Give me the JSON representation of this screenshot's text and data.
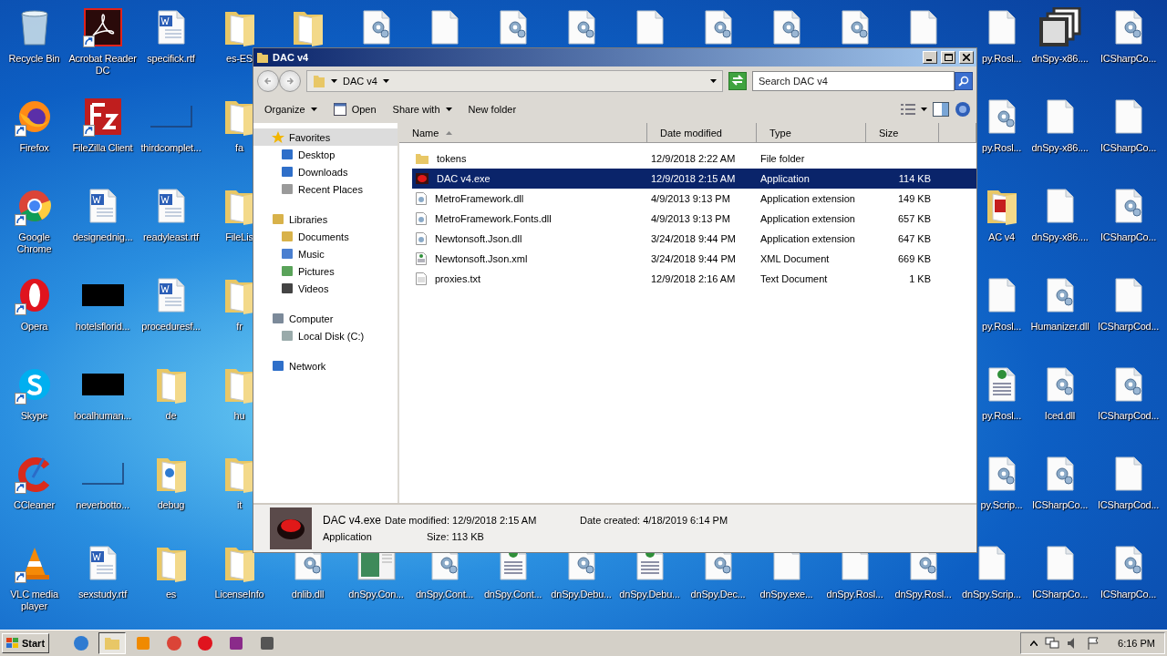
{
  "desktop": {
    "columns": [
      {
        "kind": "full",
        "items": [
          {
            "kind": "recycle",
            "label": "Recycle Bin",
            "shortcut": false
          },
          {
            "kind": "firefox",
            "label": "Firefox",
            "shortcut": true
          },
          {
            "kind": "chrome",
            "label": "Google Chrome",
            "shortcut": true
          },
          {
            "kind": "opera",
            "label": "Opera",
            "shortcut": true
          },
          {
            "kind": "skype",
            "label": "Skype",
            "shortcut": true
          },
          {
            "kind": "ccleaner",
            "label": "CCleaner",
            "shortcut": true
          },
          {
            "kind": "vlc",
            "label": "VLC media player",
            "shortcut": true
          }
        ]
      },
      {
        "kind": "full",
        "items": [
          {
            "kind": "acrobat",
            "label": "Acrobat Reader DC",
            "shortcut": true
          },
          {
            "kind": "filezilla",
            "label": "FileZilla Client",
            "shortcut": true
          },
          {
            "kind": "word",
            "label": "designednig...",
            "shortcut": false
          },
          {
            "kind": "redacted",
            "label": "hotelsflorid...",
            "shortcut": false
          },
          {
            "kind": "redacted",
            "label": "localhuman...",
            "shortcut": false
          },
          {
            "kind": "thin",
            "label": "neverbotto...",
            "shortcut": false
          },
          {
            "kind": "word",
            "label": "sexstudy.rtf",
            "shortcut": false
          }
        ]
      },
      {
        "kind": "full",
        "items": [
          {
            "kind": "word",
            "label": "specifick.rtf",
            "shortcut": false
          },
          {
            "kind": "thin",
            "label": "thirdcomplet...",
            "shortcut": false
          },
          {
            "kind": "word",
            "label": "readyleast.rtf",
            "shortcut": false
          },
          {
            "kind": "word",
            "label": "proceduresf...",
            "shortcut": false
          },
          {
            "kind": "folder",
            "label": "de",
            "shortcut": false
          },
          {
            "kind": "folderweb",
            "label": "debug",
            "shortcut": false
          },
          {
            "kind": "folder",
            "label": "es",
            "shortcut": false
          }
        ]
      },
      {
        "kind": "full",
        "items": [
          {
            "kind": "folder",
            "label": "es-ES",
            "shortcut": false
          },
          {
            "kind": "folder",
            "label": "fa",
            "shortcut": false
          },
          {
            "kind": "folder",
            "label": "FileLis",
            "shortcut": false
          },
          {
            "kind": "folder",
            "label": "fr",
            "shortcut": false
          },
          {
            "kind": "folder",
            "label": "hu",
            "shortcut": false
          },
          {
            "kind": "folder",
            "label": "it",
            "shortcut": false
          },
          {
            "kind": "folder",
            "label": "LicenseInfo",
            "shortcut": false
          }
        ]
      },
      {
        "kind": "edges",
        "items": [
          {
            "kind": "folder",
            "shortcut": false
          },
          {
            "kind": "gear",
            "label": "dnlib.dll",
            "shortcut": false
          }
        ]
      },
      {
        "kind": "edges",
        "items": [
          {
            "kind": "gear",
            "shortcut": false
          },
          {
            "kind": "image",
            "label": "dnSpy.Con...",
            "shortcut": false
          }
        ]
      },
      {
        "kind": "edges",
        "items": [
          {
            "kind": "blank",
            "shortcut": false
          },
          {
            "kind": "gear",
            "label": "dnSpy.Cont...",
            "shortcut": false
          }
        ]
      },
      {
        "kind": "edges",
        "items": [
          {
            "kind": "gear",
            "shortcut": false
          },
          {
            "kind": "web",
            "label": "dnSpy.Cont...",
            "shortcut": false
          }
        ]
      },
      {
        "kind": "edges",
        "items": [
          {
            "kind": "gear",
            "shortcut": false
          },
          {
            "kind": "gear",
            "label": "dnSpy.Debu...",
            "shortcut": false
          }
        ]
      },
      {
        "kind": "edges",
        "items": [
          {
            "kind": "blank",
            "shortcut": false
          },
          {
            "kind": "web",
            "label": "dnSpy.Debu...",
            "shortcut": false
          }
        ]
      },
      {
        "kind": "edges",
        "items": [
          {
            "kind": "gear",
            "shortcut": false
          },
          {
            "kind": "gear",
            "label": "dnSpy.Dec...",
            "shortcut": false
          }
        ]
      },
      {
        "kind": "edges",
        "items": [
          {
            "kind": "gear",
            "shortcut": false
          },
          {
            "kind": "blank",
            "label": "dnSpy.exe...",
            "shortcut": false
          }
        ]
      },
      {
        "kind": "edges",
        "items": [
          {
            "kind": "gear",
            "shortcut": false
          },
          {
            "kind": "blank",
            "label": "dnSpy.Rosl...",
            "shortcut": false
          }
        ]
      },
      {
        "kind": "edges",
        "items": [
          {
            "kind": "blank",
            "shortcut": false
          },
          {
            "kind": "gear",
            "label": "dnSpy.Rosl...",
            "shortcut": false
          }
        ]
      },
      {
        "kind": "full",
        "items": [
          {
            "kind": "blank",
            "label": "py.Rosl...",
            "shortcut": false
          },
          {
            "kind": "gear",
            "label": "py.Rosl...",
            "shortcut": false
          },
          {
            "kind": "folderred",
            "label": "AC v4",
            "shortcut": false
          },
          {
            "kind": "blank",
            "label": "py.Rosl...",
            "shortcut": false
          },
          {
            "kind": "web",
            "label": "py.Rosl...",
            "shortcut": false
          },
          {
            "kind": "gear",
            "label": "py.Scrip...",
            "shortcut": false
          },
          {
            "kind": "blank",
            "label": "dnSpy.Scrip...",
            "shortcut": false
          }
        ]
      },
      {
        "kind": "full",
        "items": [
          {
            "kind": "stack",
            "label": "dnSpy-x86....",
            "shortcut": false
          },
          {
            "kind": "blank",
            "label": "dnSpy-x86....",
            "shortcut": false
          },
          {
            "kind": "blank",
            "label": "dnSpy-x86....",
            "shortcut": false
          },
          {
            "kind": "gear",
            "label": "Humanizer.dll",
            "shortcut": false
          },
          {
            "kind": "gear",
            "label": "Iced.dll",
            "shortcut": false
          },
          {
            "kind": "gear",
            "label": "ICSharpCo...",
            "shortcut": false
          },
          {
            "kind": "blank",
            "label": "ICSharpCo...",
            "shortcut": false
          }
        ]
      },
      {
        "kind": "full",
        "items": [
          {
            "kind": "gear",
            "label": "ICSharpCo...",
            "shortcut": false
          },
          {
            "kind": "blank",
            "label": "ICSharpCo...",
            "shortcut": false
          },
          {
            "kind": "gear",
            "label": "ICSharpCo...",
            "shortcut": false
          },
          {
            "kind": "blank",
            "label": "ICSharpCod...",
            "shortcut": false
          },
          {
            "kind": "gear",
            "label": "ICSharpCod...",
            "shortcut": false
          },
          {
            "kind": "blank",
            "label": "ICSharpCod...",
            "shortcut": false
          },
          {
            "kind": "gear",
            "label": "ICSharpCo...",
            "shortcut": false
          }
        ]
      }
    ]
  },
  "window": {
    "title": "DAC v4",
    "address": "DAC v4",
    "search": {
      "placeholder": "Search DAC v4"
    },
    "toolbar": [
      {
        "kind": "menu",
        "label": "Organize"
      },
      {
        "kind": "open",
        "label": "Open"
      },
      {
        "kind": "menu",
        "label": "Share with"
      },
      {
        "kind": "plain",
        "label": "New folder"
      }
    ],
    "nav": [
      {
        "kind": "star",
        "label": "Favorites",
        "selected": true,
        "children": [
          {
            "kind": "desktop",
            "label": "Desktop",
            "selected": false
          },
          {
            "kind": "downloads",
            "label": "Downloads",
            "selected": false
          },
          {
            "kind": "recent",
            "label": "Recent Places",
            "selected": false
          }
        ]
      },
      {
        "kind": "library",
        "label": "Libraries",
        "selected": false,
        "children": [
          {
            "kind": "documents",
            "label": "Documents",
            "selected": false
          },
          {
            "kind": "music",
            "label": "Music",
            "selected": false
          },
          {
            "kind": "pictures",
            "label": "Pictures",
            "selected": false
          },
          {
            "kind": "videos",
            "label": "Videos",
            "selected": false
          }
        ]
      },
      {
        "kind": "computer",
        "label": "Computer",
        "selected": false,
        "children": [
          {
            "kind": "disk",
            "label": "Local Disk (C:)",
            "selected": false
          }
        ]
      },
      {
        "kind": "network",
        "label": "Network",
        "selected": false
      }
    ],
    "columns": [
      {
        "label": "Name",
        "sorted": true
      },
      {
        "label": "Date modified",
        "sorted": false
      },
      {
        "label": "Type",
        "sorted": false
      },
      {
        "label": "Size",
        "sorted": false
      }
    ],
    "files": [
      {
        "kind": "folder",
        "name": "tokens",
        "date": "12/9/2018 2:22 AM",
        "type": "File folder",
        "selected": false
      },
      {
        "kind": "exe",
        "name": "DAC v4.exe",
        "date": "12/9/2018 2:15 AM",
        "type": "Application",
        "size": "114 KB",
        "selected": true
      },
      {
        "kind": "dll",
        "name": "MetroFramework.dll",
        "date": "4/9/2013 9:13 PM",
        "type": "Application extension",
        "size": "149 KB",
        "selected": false
      },
      {
        "kind": "dll",
        "name": "MetroFramework.Fonts.dll",
        "date": "4/9/2013 9:13 PM",
        "type": "Application extension",
        "size": "657 KB",
        "selected": false
      },
      {
        "kind": "dll",
        "name": "Newtonsoft.Json.dll",
        "date": "3/24/2018 9:44 PM",
        "type": "Application extension",
        "size": "647 KB",
        "selected": false
      },
      {
        "kind": "xml",
        "name": "Newtonsoft.Json.xml",
        "date": "3/24/2018 9:44 PM",
        "type": "XML Document",
        "size": "669 KB",
        "selected": false
      },
      {
        "kind": "txt",
        "name": "proxies.txt",
        "date": "12/9/2018 2:16 AM",
        "type": "Text Document",
        "size": "1 KB",
        "selected": false
      }
    ],
    "details": {
      "name": "DAC v4.exe",
      "type": "Application",
      "modified": "Date modified: 12/9/2018 2:15 AM",
      "size": "Size: 113 KB",
      "created": "Date created: 4/18/2019 6:14 PM"
    }
  },
  "taskbar": {
    "start": "Start",
    "apps": [
      {
        "kind": "ie",
        "active": false
      },
      {
        "kind": "explorer",
        "active": true
      },
      {
        "kind": "media",
        "active": false
      },
      {
        "kind": "chrome",
        "active": false
      },
      {
        "kind": "opera",
        "active": false
      },
      {
        "kind": "winrar",
        "active": false
      },
      {
        "kind": "switcher",
        "active": false
      }
    ],
    "clock": "6:16 PM"
  }
}
